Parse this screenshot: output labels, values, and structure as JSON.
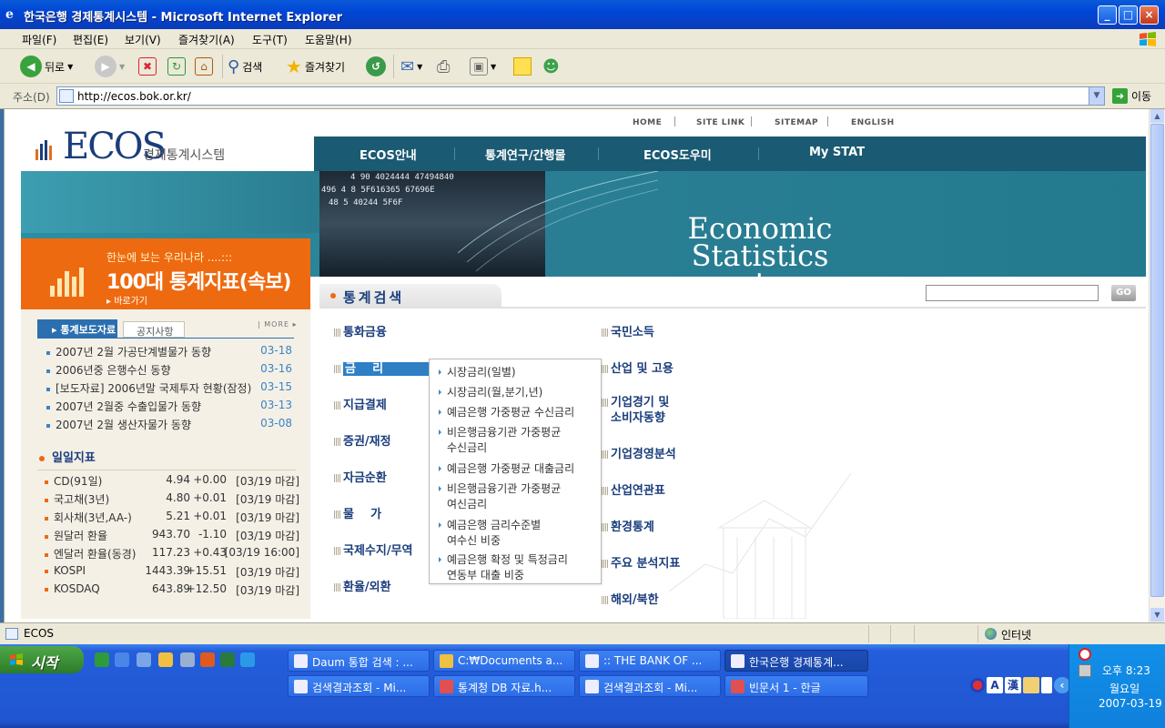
{
  "window": {
    "title": "한국은행 경제통계시스템 - Microsoft Internet Explorer",
    "controls": {
      "minimize": "_",
      "maximize": "□",
      "close": "×"
    }
  },
  "menu": [
    "파일(F)",
    "편집(E)",
    "보기(V)",
    "즐겨찾기(A)",
    "도구(T)",
    "도움말(H)"
  ],
  "toolbar": {
    "back": "뒤로",
    "search": "검색",
    "favorites": "즐겨찾기"
  },
  "address": {
    "label": "주소(D)",
    "url": "http://ecos.bok.or.kr/",
    "go": "이동"
  },
  "site": {
    "top_links": [
      "HOME",
      "SITE LINK",
      "SITEMAP",
      "ENGLISH"
    ],
    "logo": "ECOS",
    "logo_sub": "경제통계시스템",
    "nav": [
      "ECOS안내",
      "통계연구/간행물",
      "ECOS도우미",
      "My STAT"
    ],
    "banner": {
      "line1": "Economic",
      "line2": "Statistics system",
      "numbers": [
        "4 90  4024444  47494840",
        "496 4 8   5F616365  67696E",
        "48  5     40244  5F6F"
      ]
    },
    "promo": {
      "line1": "한눈에 보는 우리나라 ....:::",
      "line2": "100대 통계지표(속보)",
      "link": "▸ 바로가기"
    },
    "tabs": {
      "active": "▸ 통계보도자료",
      "inactive": "공지사항",
      "more": "| MORE ▸"
    },
    "news": [
      {
        "title": "2007년 2월 가공단계별물가 동향",
        "date": "03-18"
      },
      {
        "title": "2006년중 은행수신 동향",
        "date": "03-16"
      },
      {
        "title": "[보도자료] 2006년말 국제투자 현황(잠정)",
        "date": "03-15"
      },
      {
        "title": "2007년 2월중 수출입물가 동향",
        "date": "03-13"
      },
      {
        "title": "2007년 2월 생산자물가 동향",
        "date": "03-08"
      }
    ],
    "daily_title": "일일지표",
    "indicators": [
      {
        "name": "CD(91일)",
        "value": "4.94",
        "change": "+0.00",
        "time": "[03/19 마감]"
      },
      {
        "name": "국고채(3년)",
        "value": "4.80",
        "change": "+0.01",
        "time": "[03/19 마감]"
      },
      {
        "name": "회사채(3년,AA-)",
        "value": "5.21",
        "change": "+0.01",
        "time": "[03/19 마감]"
      },
      {
        "name": "원달러 환율",
        "value": "943.70",
        "change": "-1.10",
        "time": "[03/19 마감]"
      },
      {
        "name": "엔달러 환율(동경)",
        "value": "117.23",
        "change": "+0.43",
        "time": "[03/19 16:00]"
      },
      {
        "name": "KOSPI",
        "value": "1443.39",
        "change": "+15.51",
        "time": "[03/19 마감]"
      },
      {
        "name": "KOSDAQ",
        "value": "643.89",
        "change": "+12.50",
        "time": "[03/19 마감]"
      }
    ],
    "search_title": "통계검색",
    "search_go": "GO",
    "categories_left": [
      "통화금융",
      "금    리",
      "지급결제",
      "증권/재정",
      "자금순환",
      "물    가",
      "국제수지/무역",
      "환율/외환"
    ],
    "categories_right": [
      "국민소득",
      "산업 및 고용",
      "기업경기 및\n소비자동향",
      "기업경영분석",
      "산업연관표",
      "환경통계",
      "주요 분석지표",
      "해외/북한"
    ],
    "submenu": [
      "시장금리(일별)",
      "시장금리(월,분기,년)",
      "예금은행 가중평균 수신금리",
      "비은행금융기관 가중평균\n수신금리",
      "예금은행 가중평균 대출금리",
      "비은행금융기관 가중평균\n여신금리",
      "예금은행 금리수준별\n여수신 비중",
      "예금은행 확정 및 특정금리\n연동부 대출 비중"
    ]
  },
  "status": {
    "text": "ECOS",
    "zone": "인터넷"
  },
  "taskbar": {
    "start": "시작",
    "tasks_row1": [
      "Daum 통합 검색 : ...",
      "C:₩Documents a...",
      ":: THE BANK OF ...",
      "한국은행 경제통계..."
    ],
    "tasks_row2": [
      "검색결과조회 - Mi...",
      "통계청 DB 자료.h...",
      "검색결과조회 - Mi...",
      "빈문서 1 - 한글"
    ],
    "clock": {
      "time": "오후 8:23",
      "day": "월요일",
      "date": "2007-03-19"
    },
    "lang": [
      "A",
      "漢"
    ]
  }
}
